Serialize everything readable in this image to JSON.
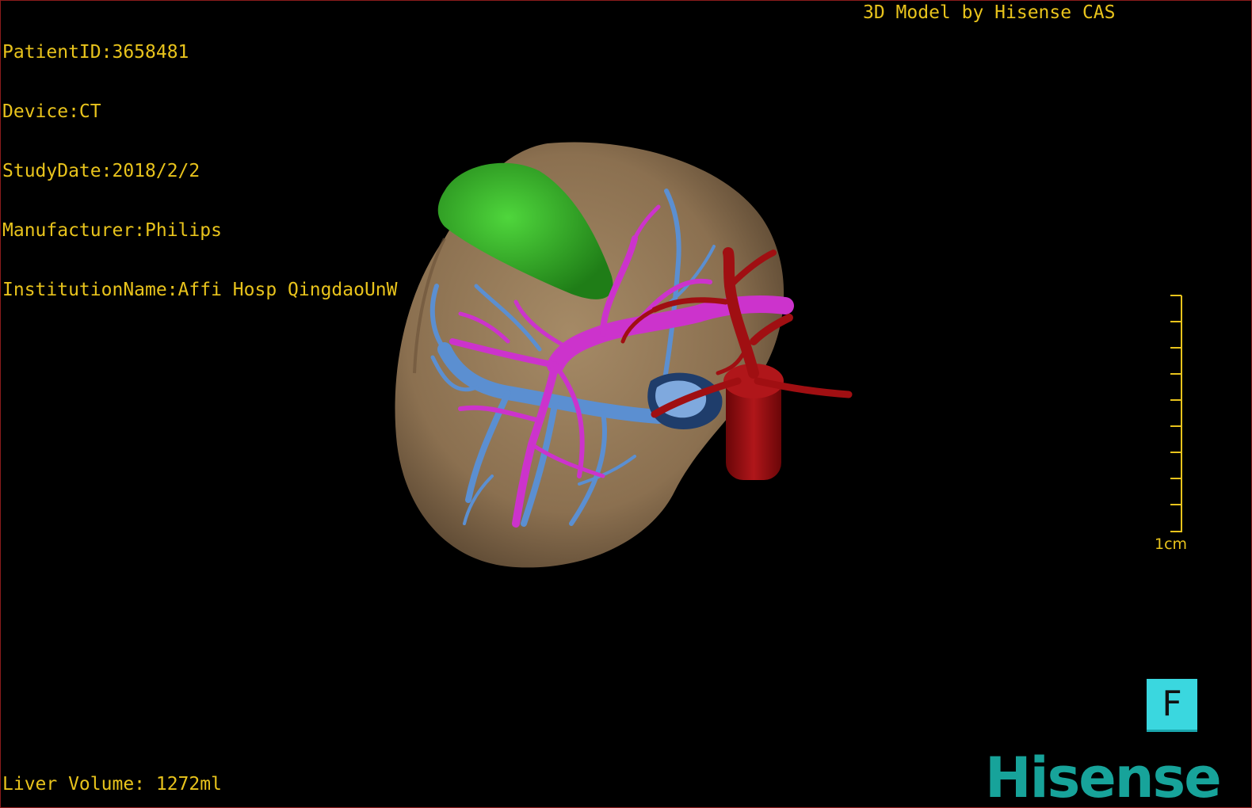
{
  "patient_info": {
    "patient_id": "PatientID:3658481",
    "device": "Device:CT",
    "study_date": "StudyDate:2018/2/2",
    "manufacturer": "Manufacturer:Philips",
    "institution": "InstitutionName:Affi Hosp QingdaoUnW"
  },
  "credit": "3D Model by Hisense CAS",
  "liver_volume": "Liver Volume: 1272ml",
  "scale_bar": {
    "label": "1cm"
  },
  "orientation_cube": {
    "label": "F"
  },
  "brand_logo": "Hisense",
  "colors": {
    "overlay_text": "#e8c31c",
    "liver": "#8b7050",
    "gallbladder": "#2fa323",
    "portal_vein": "#cc33cc",
    "hepatic_vein": "#5b8fd1",
    "artery_ivc": "#a00f12",
    "orientation_cube": "#3ad7df",
    "logo": "#17a39a"
  }
}
